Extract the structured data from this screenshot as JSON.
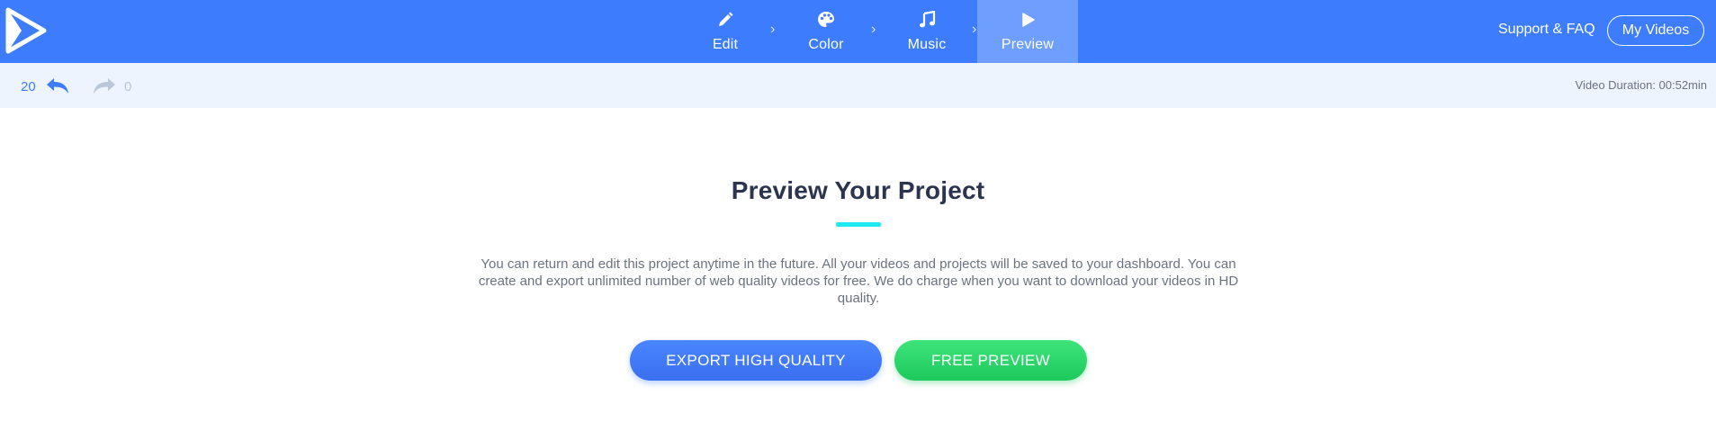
{
  "nav": {
    "steps": [
      {
        "label": "Edit",
        "icon": "pencil-icon"
      },
      {
        "label": "Color",
        "icon": "palette-icon"
      },
      {
        "label": "Music",
        "icon": "music-note-icon"
      },
      {
        "label": "Preview",
        "icon": "play-icon",
        "active": true
      }
    ],
    "support_label": "Support & FAQ",
    "my_videos_label": "My Videos"
  },
  "toolbar": {
    "undo_count": "20",
    "redo_count": "0",
    "duration": "Video Duration: 00:52min"
  },
  "main": {
    "title": "Preview Your Project",
    "description_lines": [
      "You can return and edit this project anytime in the future. All your videos and projects will be saved to your dashboard. You can",
      "create and export unlimited number of web quality videos for free. We do charge when you want to download your videos in HD",
      "quality."
    ],
    "export_button": "EXPORT HIGH QUALITY",
    "preview_button": "FREE PREVIEW"
  },
  "colors": {
    "primary": "#3d7dfd",
    "accent": "#1de9f0",
    "green": "#22cf62"
  }
}
